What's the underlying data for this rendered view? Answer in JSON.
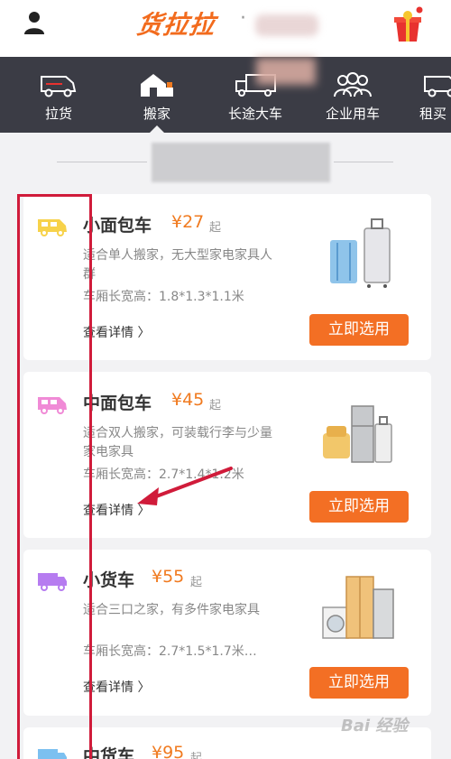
{
  "header": {
    "brand": "货拉拉",
    "dot": "·",
    "icons": {
      "user": "user-icon",
      "gift": "gift-icon"
    }
  },
  "nav": {
    "items": [
      {
        "label": "拉货",
        "icon": "van-icon"
      },
      {
        "label": "搬家",
        "icon": "house-icon",
        "active": true
      },
      {
        "label": "长途大车",
        "icon": "truck-icon"
      },
      {
        "label": "企业用车",
        "icon": "people-icon"
      },
      {
        "label": "租买",
        "icon": "van-icon"
      }
    ]
  },
  "vehicles": [
    {
      "name": "小面包车",
      "price": "¥27",
      "suffix": "起",
      "desc": "适合单人搬家，无大型家电家具人群",
      "dims": "车厢长宽高：1.8*1.3*1.1米",
      "detail": "查看详情 〉",
      "button": "立即选用",
      "icon_color": "#f7d24a"
    },
    {
      "name": "中面包车",
      "price": "¥45",
      "suffix": "起",
      "desc": "适合双人搬家，可装载行李与少量家电家具",
      "dims": "车厢长宽高：2.7*1.4*1.2米",
      "detail": "查看详情 〉",
      "button": "立即选用",
      "icon_color": "#f08ad6"
    },
    {
      "name": "小货车",
      "price": "¥55",
      "suffix": "起",
      "desc": "适合三口之家，有多件家电家具",
      "dims": "车厢长宽高：2.7*1.5*1.7米…",
      "detail": "查看详情 〉",
      "button": "立即选用",
      "icon_color": "#b67cf0"
    },
    {
      "name": "中货车",
      "price": "¥95",
      "suffix": "起",
      "icon_color": "#7cc0f0"
    }
  ],
  "watermark": "Bai 经验",
  "colors": {
    "accent": "#f36f24",
    "price": "#f07a1f",
    "nav_bg": "#3b3c45",
    "annotation": "#d01b3a"
  }
}
